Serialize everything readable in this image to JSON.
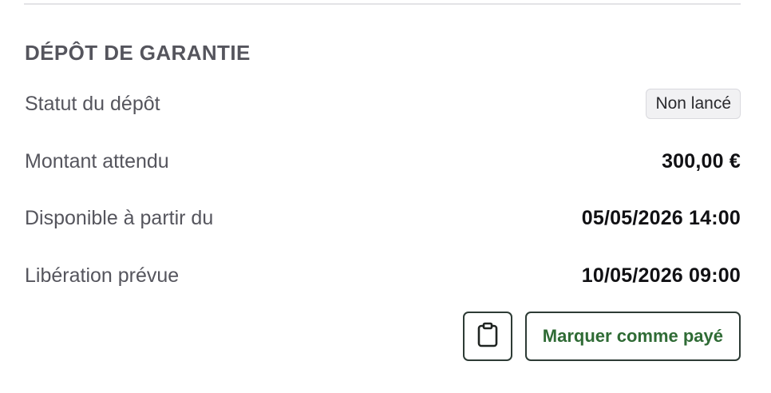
{
  "section": {
    "title": "DÉPÔT DE GARANTIE"
  },
  "rows": [
    {
      "label": "Statut du dépôt",
      "value": "Non lancé"
    },
    {
      "label": "Montant attendu",
      "value": "300,00 €"
    },
    {
      "label": "Disponible à partir du",
      "value": "05/05/2026 14:00"
    },
    {
      "label": "Libération prévue",
      "value": "10/05/2026 09:00"
    }
  ],
  "actions": {
    "copy_icon": "clipboard-icon",
    "mark_paid_label": "Marquer comme payé"
  },
  "colors": {
    "accent_text": "#2f6b35",
    "button_border": "#2d3b35",
    "label_text": "#55555d",
    "badge_bg": "#f1f1f3"
  }
}
